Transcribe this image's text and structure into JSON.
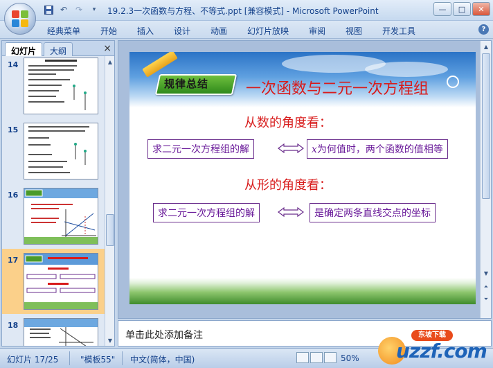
{
  "window": {
    "title": "19.2.3一次函数与方程、不等式.ppt [兼容模式] - Microsoft PowerPoint",
    "controls": [
      "—",
      "□",
      "✕"
    ]
  },
  "quick_access": {
    "icons": [
      "save-icon",
      "undo-icon",
      "redo-icon",
      "customize-icon"
    ]
  },
  "menu": {
    "items": [
      "经典菜单",
      "开始",
      "插入",
      "设计",
      "动画",
      "幻灯片放映",
      "审阅",
      "视图",
      "开发工具"
    ],
    "help": "?"
  },
  "left_pane": {
    "tabs": [
      "幻灯片",
      "大纲"
    ],
    "close": "×",
    "slides": [
      {
        "number": "14",
        "selected": false
      },
      {
        "number": "15",
        "selected": false
      },
      {
        "number": "16",
        "selected": false
      },
      {
        "number": "17",
        "selected": true
      },
      {
        "number": "18",
        "selected": false
      }
    ]
  },
  "slide": {
    "badge": "规律总结",
    "title": "一次函数与二元一次方程组",
    "section1": "从数的角度看：",
    "box1_left": "求二元一次方程组的解",
    "box1_right_var": "x",
    "box1_right": "为何值时，两个函数的值相等",
    "section2": "从形的角度看：",
    "box2_left": "求二元一次方程组的解",
    "box2_right": "是确定两条直线交点的坐标"
  },
  "notes": {
    "placeholder": "单击此处添加备注"
  },
  "status": {
    "slide_counter": "幻灯片 17/25",
    "theme": "\"模板55\"",
    "language": "中文(简体，中国)",
    "zoom": "50%"
  },
  "watermark": {
    "text": "uzzf.com",
    "label": "东坡下载"
  },
  "colors": {
    "accent": "#15428b",
    "slide_red": "#d81c1c",
    "box_purple": "#6a2d8c",
    "selected_thumb": "#fbd08a"
  }
}
